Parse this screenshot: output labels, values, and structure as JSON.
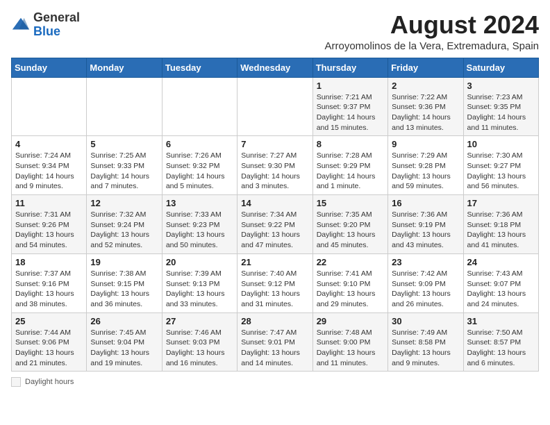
{
  "logo": {
    "general": "General",
    "blue": "Blue"
  },
  "title": "August 2024",
  "subtitle": "Arroyomolinos de la Vera, Extremadura, Spain",
  "headers": [
    "Sunday",
    "Monday",
    "Tuesday",
    "Wednesday",
    "Thursday",
    "Friday",
    "Saturday"
  ],
  "weeks": [
    [
      {
        "num": "",
        "info": ""
      },
      {
        "num": "",
        "info": ""
      },
      {
        "num": "",
        "info": ""
      },
      {
        "num": "",
        "info": ""
      },
      {
        "num": "1",
        "info": "Sunrise: 7:21 AM\nSunset: 9:37 PM\nDaylight: 14 hours and 15 minutes."
      },
      {
        "num": "2",
        "info": "Sunrise: 7:22 AM\nSunset: 9:36 PM\nDaylight: 14 hours and 13 minutes."
      },
      {
        "num": "3",
        "info": "Sunrise: 7:23 AM\nSunset: 9:35 PM\nDaylight: 14 hours and 11 minutes."
      }
    ],
    [
      {
        "num": "4",
        "info": "Sunrise: 7:24 AM\nSunset: 9:34 PM\nDaylight: 14 hours and 9 minutes."
      },
      {
        "num": "5",
        "info": "Sunrise: 7:25 AM\nSunset: 9:33 PM\nDaylight: 14 hours and 7 minutes."
      },
      {
        "num": "6",
        "info": "Sunrise: 7:26 AM\nSunset: 9:32 PM\nDaylight: 14 hours and 5 minutes."
      },
      {
        "num": "7",
        "info": "Sunrise: 7:27 AM\nSunset: 9:30 PM\nDaylight: 14 hours and 3 minutes."
      },
      {
        "num": "8",
        "info": "Sunrise: 7:28 AM\nSunset: 9:29 PM\nDaylight: 14 hours and 1 minute."
      },
      {
        "num": "9",
        "info": "Sunrise: 7:29 AM\nSunset: 9:28 PM\nDaylight: 13 hours and 59 minutes."
      },
      {
        "num": "10",
        "info": "Sunrise: 7:30 AM\nSunset: 9:27 PM\nDaylight: 13 hours and 56 minutes."
      }
    ],
    [
      {
        "num": "11",
        "info": "Sunrise: 7:31 AM\nSunset: 9:26 PM\nDaylight: 13 hours and 54 minutes."
      },
      {
        "num": "12",
        "info": "Sunrise: 7:32 AM\nSunset: 9:24 PM\nDaylight: 13 hours and 52 minutes."
      },
      {
        "num": "13",
        "info": "Sunrise: 7:33 AM\nSunset: 9:23 PM\nDaylight: 13 hours and 50 minutes."
      },
      {
        "num": "14",
        "info": "Sunrise: 7:34 AM\nSunset: 9:22 PM\nDaylight: 13 hours and 47 minutes."
      },
      {
        "num": "15",
        "info": "Sunrise: 7:35 AM\nSunset: 9:20 PM\nDaylight: 13 hours and 45 minutes."
      },
      {
        "num": "16",
        "info": "Sunrise: 7:36 AM\nSunset: 9:19 PM\nDaylight: 13 hours and 43 minutes."
      },
      {
        "num": "17",
        "info": "Sunrise: 7:36 AM\nSunset: 9:18 PM\nDaylight: 13 hours and 41 minutes."
      }
    ],
    [
      {
        "num": "18",
        "info": "Sunrise: 7:37 AM\nSunset: 9:16 PM\nDaylight: 13 hours and 38 minutes."
      },
      {
        "num": "19",
        "info": "Sunrise: 7:38 AM\nSunset: 9:15 PM\nDaylight: 13 hours and 36 minutes."
      },
      {
        "num": "20",
        "info": "Sunrise: 7:39 AM\nSunset: 9:13 PM\nDaylight: 13 hours and 33 minutes."
      },
      {
        "num": "21",
        "info": "Sunrise: 7:40 AM\nSunset: 9:12 PM\nDaylight: 13 hours and 31 minutes."
      },
      {
        "num": "22",
        "info": "Sunrise: 7:41 AM\nSunset: 9:10 PM\nDaylight: 13 hours and 29 minutes."
      },
      {
        "num": "23",
        "info": "Sunrise: 7:42 AM\nSunset: 9:09 PM\nDaylight: 13 hours and 26 minutes."
      },
      {
        "num": "24",
        "info": "Sunrise: 7:43 AM\nSunset: 9:07 PM\nDaylight: 13 hours and 24 minutes."
      }
    ],
    [
      {
        "num": "25",
        "info": "Sunrise: 7:44 AM\nSunset: 9:06 PM\nDaylight: 13 hours and 21 minutes."
      },
      {
        "num": "26",
        "info": "Sunrise: 7:45 AM\nSunset: 9:04 PM\nDaylight: 13 hours and 19 minutes."
      },
      {
        "num": "27",
        "info": "Sunrise: 7:46 AM\nSunset: 9:03 PM\nDaylight: 13 hours and 16 minutes."
      },
      {
        "num": "28",
        "info": "Sunrise: 7:47 AM\nSunset: 9:01 PM\nDaylight: 13 hours and 14 minutes."
      },
      {
        "num": "29",
        "info": "Sunrise: 7:48 AM\nSunset: 9:00 PM\nDaylight: 13 hours and 11 minutes."
      },
      {
        "num": "30",
        "info": "Sunrise: 7:49 AM\nSunset: 8:58 PM\nDaylight: 13 hours and 9 minutes."
      },
      {
        "num": "31",
        "info": "Sunrise: 7:50 AM\nSunset: 8:57 PM\nDaylight: 13 hours and 6 minutes."
      }
    ]
  ],
  "footer": {
    "label": "Daylight hours"
  }
}
